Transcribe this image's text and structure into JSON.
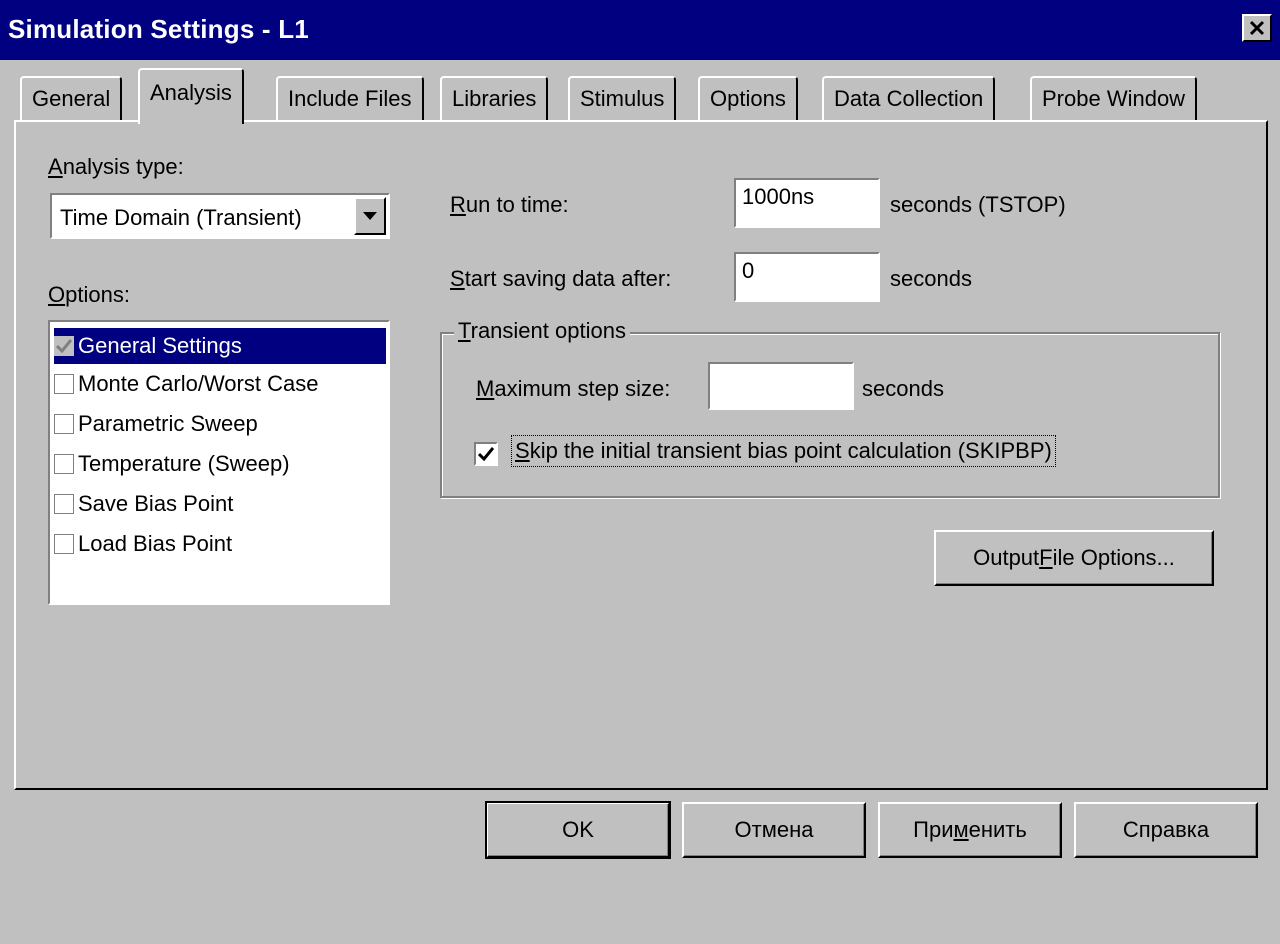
{
  "window": {
    "title": "Simulation Settings - L1",
    "close_glyph": "✕"
  },
  "tabs": [
    {
      "label": "General",
      "active": false
    },
    {
      "label": "Analysis",
      "active": true
    },
    {
      "label": "Include Files",
      "active": false
    },
    {
      "label": "Libraries",
      "active": false
    },
    {
      "label": "Stimulus",
      "active": false
    },
    {
      "label": "Options",
      "active": false
    },
    {
      "label": "Data Collection",
      "active": false
    },
    {
      "label": "Probe Window",
      "active": false
    }
  ],
  "analysis": {
    "type_label_hotkey": "A",
    "type_label_rest": "nalysis type:",
    "type_value": "Time Domain (Transient)",
    "options_label_hotkey": "O",
    "options_label_rest": "ptions:",
    "options": [
      {
        "label": "General Settings",
        "checked": true,
        "selected": true
      },
      {
        "label": "Monte Carlo/Worst Case",
        "checked": false,
        "selected": false
      },
      {
        "label": "Parametric Sweep",
        "checked": false,
        "selected": false
      },
      {
        "label": "Temperature (Sweep)",
        "checked": false,
        "selected": false
      },
      {
        "label": "Save Bias Point",
        "checked": false,
        "selected": false
      },
      {
        "label": "Load Bias Point",
        "checked": false,
        "selected": false
      }
    ]
  },
  "run_to_time": {
    "label_hotkey": "R",
    "label_rest": "un to time:",
    "value": "1000ns",
    "unit": "seconds  (TSTOP)"
  },
  "start_saving": {
    "label_hotkey": "S",
    "label_rest": "tart saving data after:",
    "value": "0",
    "unit": "seconds"
  },
  "transient_options": {
    "title_hotkey": "T",
    "title_rest": "ransient options",
    "max_step_hotkey": "M",
    "max_step_rest": "aximum step size:",
    "max_step_value": "",
    "max_step_unit": "seconds",
    "skip_checked": true,
    "skip_hotkey": "S",
    "skip_rest": "kip the initial transient bias point calculation  (SKIPBP)"
  },
  "output_file": {
    "pre": "Output ",
    "hotkey": "F",
    "post": "ile Options..."
  },
  "buttons": {
    "ok": "OK",
    "cancel": "Отмена",
    "apply_pre": "При",
    "apply_hotkey": "м",
    "apply_post": "енить",
    "help": "Справка"
  }
}
